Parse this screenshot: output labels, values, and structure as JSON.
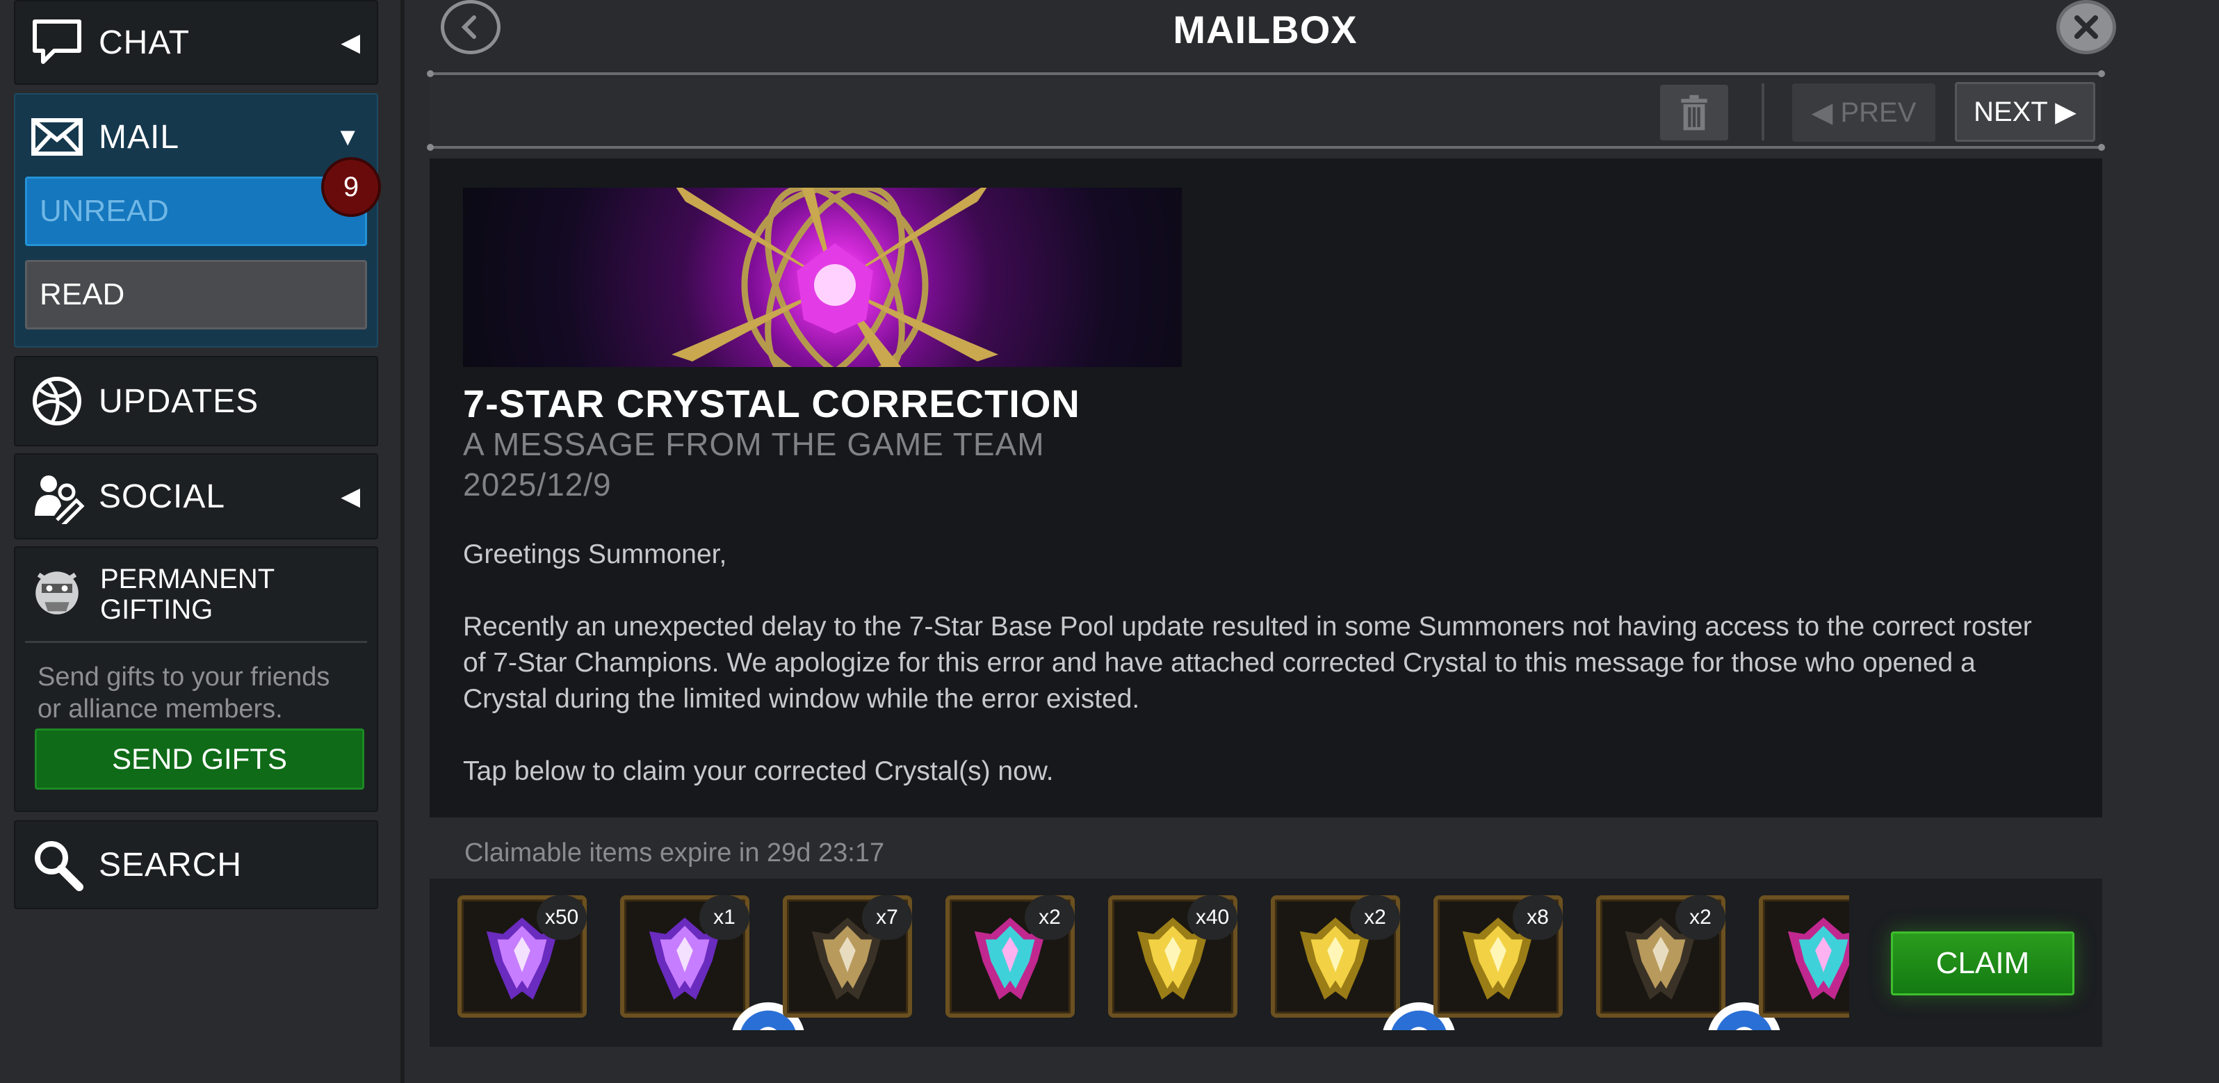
{
  "sidebar": {
    "chat": {
      "label": "CHAT",
      "icon": "chat-bubble-icon"
    },
    "mail": {
      "label": "MAIL",
      "icon": "envelope-icon",
      "unread_label": "UNREAD",
      "unread_count": "9",
      "read_label": "READ"
    },
    "updates": {
      "label": "UPDATES",
      "icon": "globe-icon"
    },
    "social": {
      "label": "SOCIAL",
      "icon": "social-people-icon"
    },
    "gifting": {
      "title_line1": "PERMANENT",
      "title_line2": "GIFTING",
      "icon": "gift-mascot-icon",
      "desc_line1": "Send gifts to your friends",
      "desc_line2": "or alliance members.",
      "button_label": "SEND GIFTS"
    },
    "search": {
      "label": "SEARCH",
      "icon": "magnifier-icon"
    }
  },
  "header": {
    "title": "MAILBOX",
    "prev_label": "◀ PREV",
    "next_label": "NEXT ▶"
  },
  "message": {
    "title": "7-STAR CRYSTAL CORRECTION",
    "from": "A MESSAGE FROM THE GAME TEAM",
    "date": "2025/12/9",
    "greeting": "Greetings Summoner,",
    "paragraph1": "Recently an unexpected delay to the 7-Star Base Pool update resulted in some Summoners not having access to the correct roster of 7-Star Champions. We apologize for this error and have attached corrected Crystal to this message for those who opened a Crystal during the limited window while the error existed.",
    "paragraph2": "Tap below to claim your corrected Crystal(s) now."
  },
  "rewards": {
    "expire_text": "Claimable items expire in 29d 23:17",
    "claim_label": "CLAIM",
    "items": [
      {
        "qty": "x50",
        "icon": "purple-crystal-icon"
      },
      {
        "qty": "x1",
        "icon": "purple-crystal-icon"
      },
      {
        "qty": "x7",
        "icon": "dark-gold-crystal-icon"
      },
      {
        "qty": "x2",
        "icon": "rainbow-crystal-icon"
      },
      {
        "qty": "x40",
        "icon": "gold-crystal-icon"
      },
      {
        "qty": "x2",
        "icon": "gold-crystal-icon"
      },
      {
        "qty": "x8",
        "icon": "gold-crystal-icon"
      },
      {
        "qty": "x2",
        "icon": "dark-gold-crystal-icon"
      },
      {
        "qty": "",
        "icon": "rainbow-crystal-icon"
      }
    ]
  },
  "colors": {
    "unread_blue": "#1577bd",
    "send_gifts_green": "#0f6b17",
    "claim_green": "#22901a",
    "badge_red": "#6a0b0b"
  }
}
